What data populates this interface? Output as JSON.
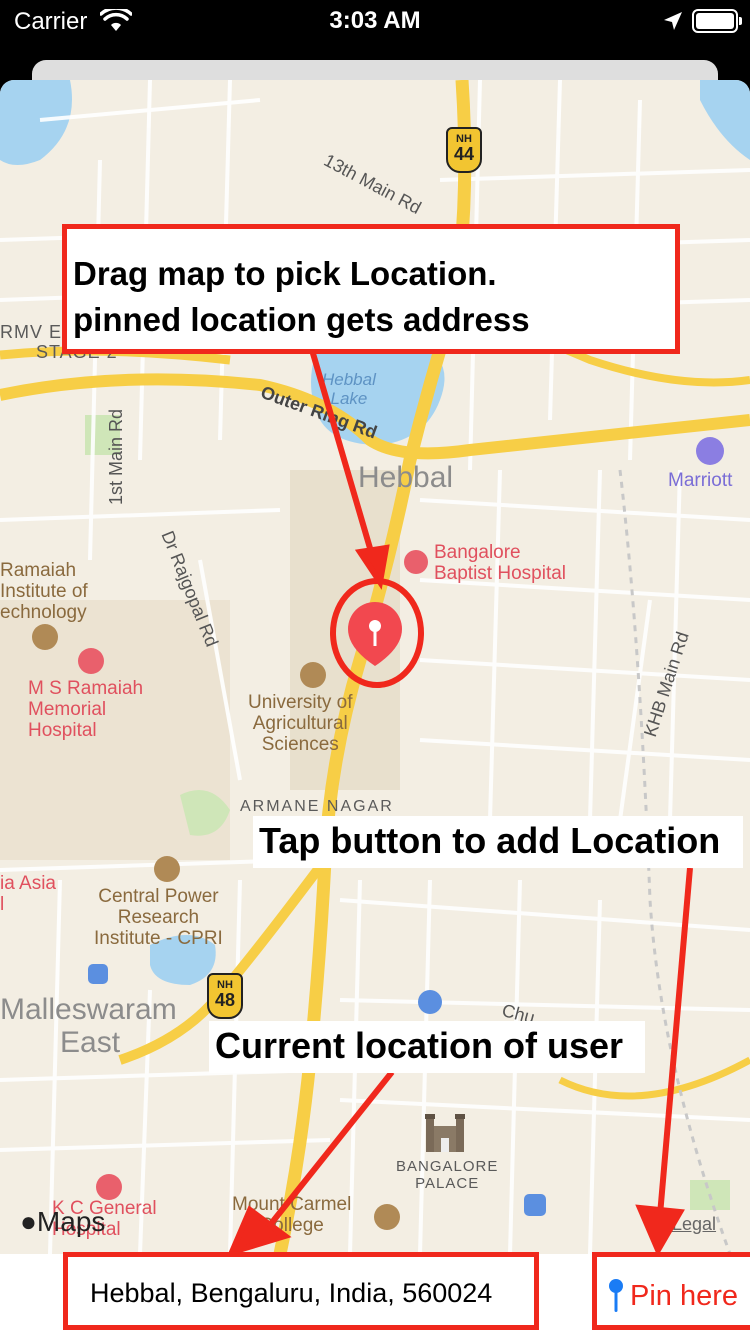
{
  "status_bar": {
    "carrier": "Carrier",
    "time": "3:03 AM"
  },
  "map": {
    "areas": {
      "hebbal": "Hebbal",
      "malleswaram": "Malleswaram",
      "east": "East",
      "rmv": "RMV EX",
      "stage2": "STAGE 2",
      "armane_nagar": "ARMANE NAGAR"
    },
    "roads": {
      "13th_main": "13th Main Rd",
      "outer_ring": "Outer Ring Rd",
      "1st_main": "1st Main Rd",
      "rajgopal": "Dr Rajgopal Rd",
      "khb_main": "KHB Main Rd",
      "chu": "Chu"
    },
    "highways": [
      {
        "prefix": "NH",
        "number": "44"
      },
      {
        "prefix": "NH",
        "number": "48"
      }
    ],
    "lake": [
      "Hebbal",
      "Lake"
    ],
    "pois": {
      "marriott": "Marriott",
      "baptist": [
        "Bangalore",
        "Baptist Hospital"
      ],
      "ramaiah_inst": [
        "Ramaiah",
        "Institute of",
        "echnology"
      ],
      "ramaiah_hospital": [
        "M S Ramaiah",
        "Memorial",
        "Hospital"
      ],
      "university": [
        "University of",
        "Agricultural",
        "Sciences"
      ],
      "asia": [
        "ia Asia",
        "l"
      ],
      "cpri": [
        "Central Power",
        "Research",
        "Institute - CPRI"
      ],
      "palace": [
        "BANGALORE",
        "PALACE"
      ],
      "kc_general": [
        "K C General",
        "Hospital"
      ],
      "mount_carmel": [
        "Mount Carmel",
        "College"
      ]
    },
    "attribution": {
      "maps": "Maps",
      "legal": "Legal"
    }
  },
  "annotations": {
    "drag": [
      "Drag map to pick Location.",
      "pinned location gets address"
    ],
    "tap": "Tap button to add Location",
    "current": "Current location of user"
  },
  "bottom": {
    "address": "Hebbal, Bengaluru, India, 560024",
    "pin_button": "Pin here"
  },
  "colors": {
    "annotation_red": "#f0281c",
    "pin_red": "#f2484f",
    "pin_button_icon": "#1a7cf5",
    "map_land": "#f3eee3",
    "water": "#a6d3f0",
    "park": "#cfe6b8",
    "major_road": "#f7ce46"
  }
}
